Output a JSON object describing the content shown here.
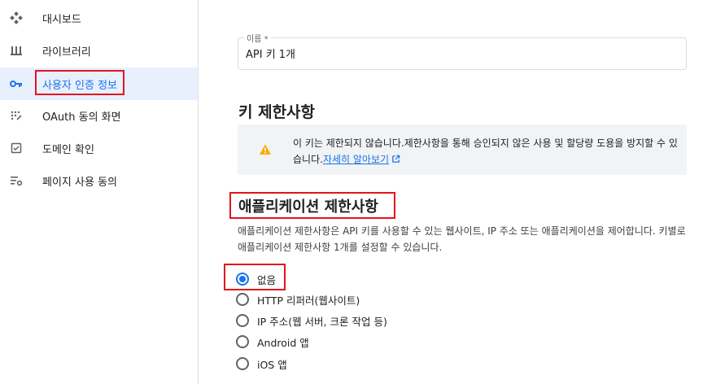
{
  "sidebar": {
    "items": [
      {
        "label": "대시보드",
        "icon": "dashboard-icon"
      },
      {
        "label": "라이브러리",
        "icon": "library-icon"
      },
      {
        "label": "사용자 인증 정보",
        "icon": "key-icon",
        "active": true
      },
      {
        "label": "OAuth 동의 화면",
        "icon": "oauth-consent-icon"
      },
      {
        "label": "도메인 확인",
        "icon": "domain-check-icon"
      },
      {
        "label": "페이지 사용 동의",
        "icon": "page-usage-settings-icon"
      }
    ]
  },
  "name_field": {
    "label": "이름 *",
    "value": "API 키 1개"
  },
  "key_restrictions": {
    "title": "키 제한사항",
    "warning_text": "이 키는 제한되지 않습니다.제한사항을 통해 승인되지 않은 사용 및 할당량 도용을 방지할 수 있습니다.",
    "learn_more": "자세히 알아보기"
  },
  "application_restrictions": {
    "title": "애플리케이션 제한사항",
    "description": "애플리케이션 제한사항은 API 키를 사용할 수 있는 웹사이트, IP 주소 또는 애플리케이션을 제어합니다. 키별로 애플리케이션 제한사항 1개를 설정할 수 있습니다.",
    "options": [
      {
        "label": "없음",
        "selected": true
      },
      {
        "label": "HTTP 리퍼러(웹사이트)",
        "selected": false
      },
      {
        "label": "IP 주소(웹 서버, 크론 작업 등)",
        "selected": false
      },
      {
        "label": "Android 앱",
        "selected": false
      },
      {
        "label": "iOS 앱",
        "selected": false
      }
    ]
  },
  "colors": {
    "accent": "#1a73e8",
    "active_nav_bg": "#e8f0fe",
    "highlight_red": "#e3141f",
    "warning_yellow": "#f9ab00"
  }
}
